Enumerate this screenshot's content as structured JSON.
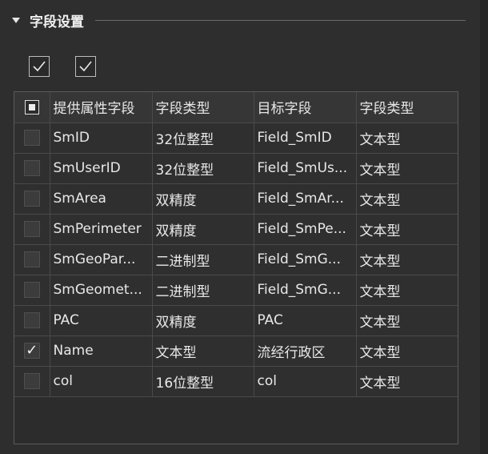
{
  "section": {
    "title": "字段设置"
  },
  "top_checkboxes": [
    {
      "checked": true
    },
    {
      "checked": true
    }
  ],
  "table": {
    "columns": [
      "提供属性字段",
      "字段类型",
      "目标字段",
      "字段类型"
    ],
    "rows": [
      {
        "checked": false,
        "source_field": "SmID",
        "source_type": "32位整型",
        "target_field": "Field_SmID",
        "target_type": "文本型"
      },
      {
        "checked": false,
        "source_field": "SmUserID",
        "source_type": "32位整型",
        "target_field": "Field_SmUs...",
        "target_type": "文本型"
      },
      {
        "checked": false,
        "source_field": "SmArea",
        "source_type": "双精度",
        "target_field": "Field_SmAr...",
        "target_type": "文本型"
      },
      {
        "checked": false,
        "source_field": "SmPerimeter",
        "source_type": "双精度",
        "target_field": "Field_SmPe...",
        "target_type": "文本型"
      },
      {
        "checked": false,
        "source_field": "SmGeoPar...",
        "source_type": "二进制型",
        "target_field": "Field_SmG...",
        "target_type": "文本型"
      },
      {
        "checked": false,
        "source_field": "SmGeomet...",
        "source_type": "二进制型",
        "target_field": "Field_SmG...",
        "target_type": "文本型"
      },
      {
        "checked": false,
        "source_field": "PAC",
        "source_type": "双精度",
        "target_field": "PAC",
        "target_type": "文本型"
      },
      {
        "checked": true,
        "source_field": "Name",
        "source_type": "文本型",
        "target_field": "流经行政区",
        "target_type": "文本型"
      },
      {
        "checked": false,
        "source_field": "col",
        "source_type": "16位整型",
        "target_field": "col",
        "target_type": "文本型"
      }
    ]
  },
  "glyphs": {
    "check": "✓"
  }
}
